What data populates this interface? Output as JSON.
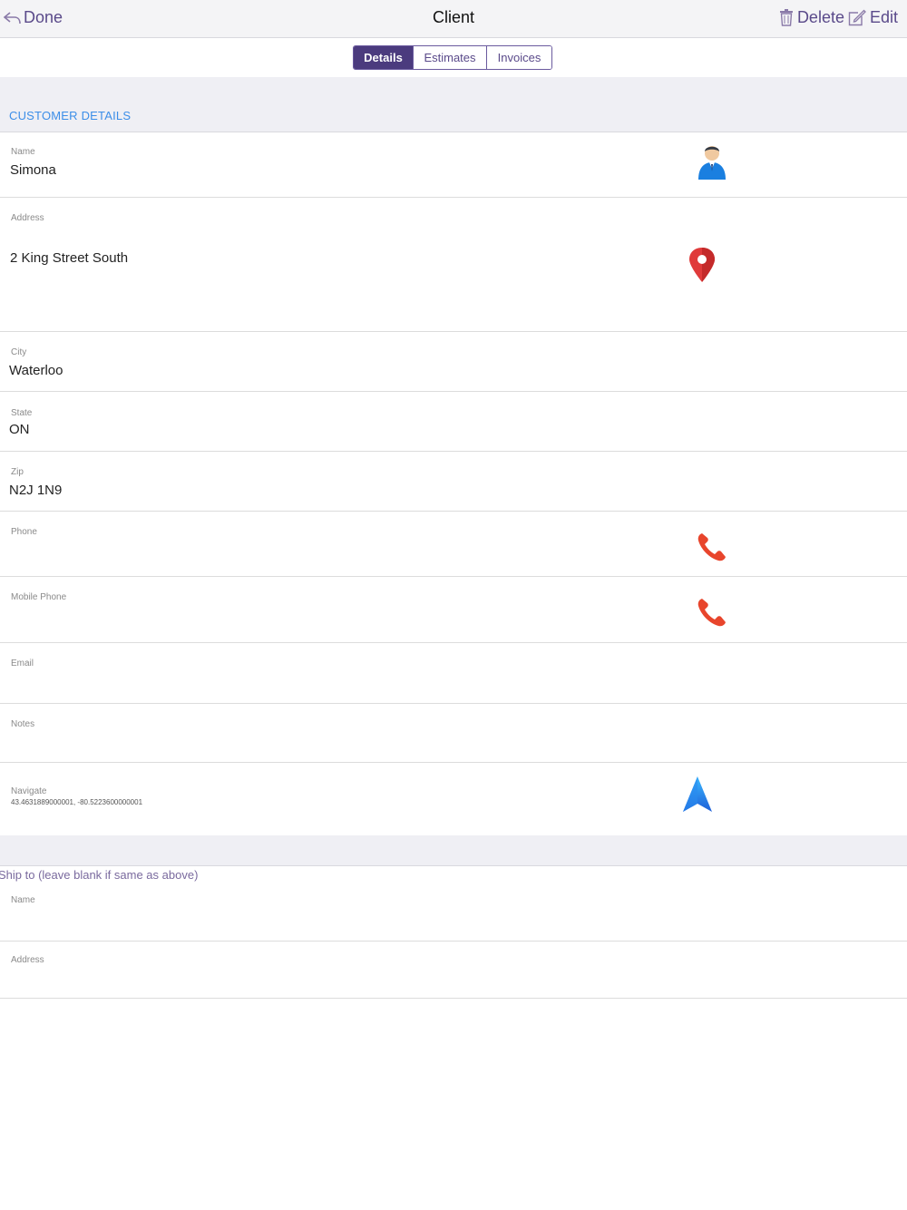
{
  "nav": {
    "back_label": "Done",
    "title": "Client",
    "delete_label": "Delete",
    "edit_label": "Edit"
  },
  "tabs": [
    {
      "label": "Details",
      "active": true
    },
    {
      "label": "Estimates",
      "active": false
    },
    {
      "label": "Invoices",
      "active": false
    }
  ],
  "customer_section": {
    "header": "CUSTOMER DETAILS",
    "name": {
      "label": "Name",
      "value": "Simona",
      "icon": "person-icon"
    },
    "address": {
      "label": "Address",
      "value": "2 King Street South",
      "icon": "map-pin-icon"
    },
    "city": {
      "label": "City",
      "value": "Waterloo"
    },
    "state": {
      "label": "State",
      "value": "ON"
    },
    "zip": {
      "label": "Zip",
      "value": "N2J 1N9"
    },
    "phone": {
      "label": "Phone",
      "value": "",
      "icon": "phone-icon"
    },
    "mobile_phone": {
      "label": "Mobile Phone",
      "value": "",
      "icon": "phone-icon"
    },
    "email": {
      "label": "Email",
      "value": ""
    },
    "notes": {
      "label": "Notes",
      "value": ""
    },
    "navigate": {
      "label": "Navigate",
      "value": "43.4631889000001, -80.5223600000001",
      "icon": "navigation-arrow-icon"
    }
  },
  "ship_section": {
    "header": "Ship to (leave blank if same as above)",
    "name": {
      "label": "Name",
      "value": ""
    },
    "address": {
      "label": "Address",
      "value": ""
    }
  },
  "colors": {
    "accent": "#4b3b7e",
    "link": "#5a4a8a",
    "section_label": "#3c8ee8",
    "phone": "#e8452c",
    "pin": "#e03a3a",
    "person": "#1a7fe0"
  }
}
